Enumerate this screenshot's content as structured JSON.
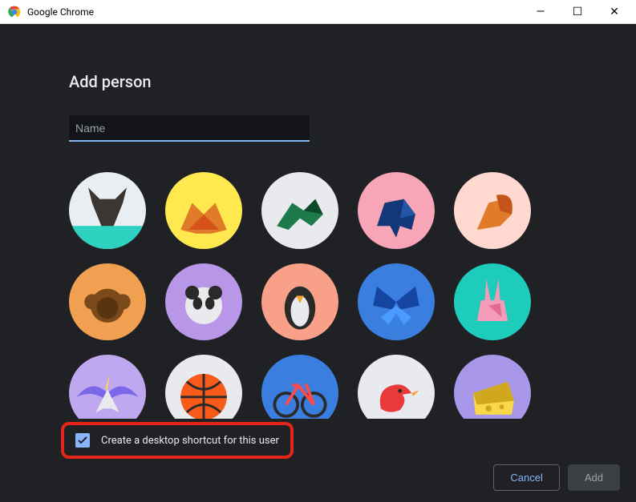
{
  "window": {
    "title": "Google Chrome",
    "minimize": "—",
    "maximize": "☐",
    "close": "✕"
  },
  "dialog": {
    "heading": "Add person",
    "name_placeholder": "Name",
    "checkbox_label": "Create a desktop shortcut for this user",
    "checkbox_checked": true,
    "cancel_label": "Cancel",
    "add_label": "Add"
  },
  "avatars": [
    {
      "id": "cat",
      "bg": "#e8eef2",
      "accent": "#3b3631",
      "accent2": "#2ed2c1"
    },
    {
      "id": "fox",
      "bg": "#ffe94f",
      "accent": "#e07b2a",
      "accent2": "#d4531a"
    },
    {
      "id": "dragon",
      "bg": "#e8eaed",
      "accent": "#1d7a4a",
      "accent2": "#0a4a2a"
    },
    {
      "id": "elephant",
      "bg": "#f8a5b8",
      "accent": "#12387a",
      "accent2": "#2456a8"
    },
    {
      "id": "squirrel",
      "bg": "#ffd9d0",
      "accent": "#e07b2a",
      "accent2": "#c4551a"
    },
    {
      "id": "monkey",
      "bg": "#f0a050",
      "accent": "#7a4a1a",
      "accent2": "#5a3410"
    },
    {
      "id": "panda",
      "bg": "#b896e8",
      "accent": "#e8eaed",
      "accent2": "#2a2a2a"
    },
    {
      "id": "penguin",
      "bg": "#f8a088",
      "accent": "#2a2a2a",
      "accent2": "#e8eaed"
    },
    {
      "id": "butterfly",
      "bg": "#3a7fe0",
      "accent": "#1445a0",
      "accent2": "#4a9aff"
    },
    {
      "id": "rabbit",
      "bg": "#1dccbb",
      "accent": "#f49bb8",
      "accent2": "#e06a95"
    },
    {
      "id": "unicorn",
      "bg": "#c0a8f0",
      "accent": "#e8eaed",
      "accent2": "#7a68e8"
    },
    {
      "id": "basketball",
      "bg": "#e8eaed",
      "accent": "#f85a1a",
      "accent2": "#2a2a2a"
    },
    {
      "id": "bicycle",
      "bg": "#3a7fe0",
      "accent": "#ff4a4a",
      "accent2": "#2a2a2a"
    },
    {
      "id": "bird",
      "bg": "#e8eaed",
      "accent": "#e83a3a",
      "accent2": "#f8a030"
    },
    {
      "id": "cheese",
      "bg": "#a896e8",
      "accent": "#f8d848",
      "accent2": "#d0a820"
    }
  ]
}
